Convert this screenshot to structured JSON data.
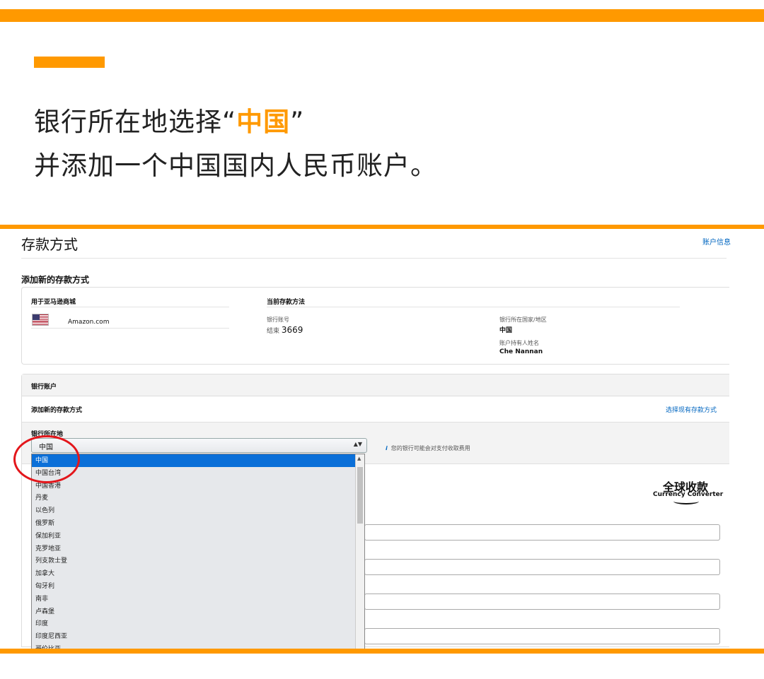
{
  "headline": {
    "line1_prefix": "银行所在地选择“",
    "line1_highlight": "中国",
    "line1_suffix": "”",
    "line2": "并添加一个中国国内人民币账户。"
  },
  "screenshot": {
    "page_title": "存款方式",
    "top_link": "账户信息",
    "section_title": "添加新的存款方式",
    "marketplace": {
      "header": "用于亚马逊商城",
      "flag_icon": "us-flag-icon",
      "name": "Amazon.com"
    },
    "current_method": {
      "header": "当前存款方法",
      "bank_account_label": "银行账号",
      "ending_prefix": "结束",
      "ending_digits": "3669",
      "country_label": "银行所在国家/地区",
      "country_value": "中国",
      "holder_label": "账户持有人姓名",
      "holder_value": "Che Nannan"
    },
    "bank_account_section": {
      "header": "银行账户",
      "add_new_label": "添加新的存款方式",
      "select_existing_link": "选择现有存款方式",
      "location_label": "银行所在地",
      "location_value": "中国",
      "info_icon": "i",
      "info_text": "您的银行可能会对支付收取费用"
    },
    "dropdown_options": [
      "中国",
      "中国台湾",
      "中国香港",
      "丹麦",
      "以色列",
      "俄罗斯",
      "保加利亚",
      "克罗地亚",
      "列支敦士登",
      "加拿大",
      "匈牙利",
      "南非",
      "卢森堡",
      "印度",
      "印度尼西亚",
      "哥伦比亚"
    ],
    "dropdown_selected": "中国",
    "logo": {
      "cn": "全球收款",
      "en": "Currency Converter"
    }
  },
  "colors": {
    "accent_orange": "#ff9900",
    "link_blue": "#0066c0",
    "selected_blue": "#0a6fd8",
    "annotation_red": "#e3161b"
  }
}
